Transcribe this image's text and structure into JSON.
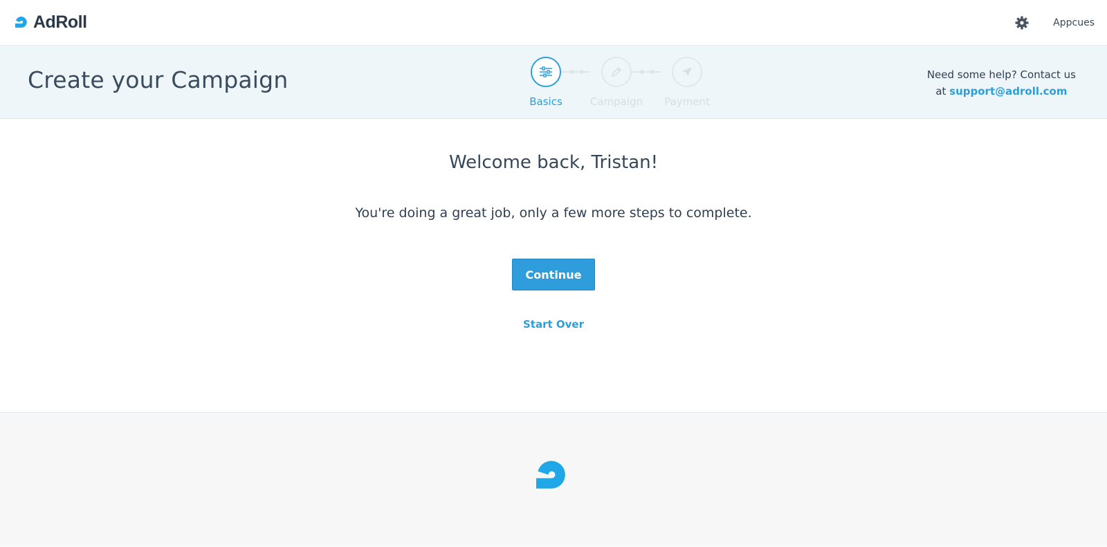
{
  "brand": {
    "name": "AdRoll",
    "accent_color": "#2c9fd9",
    "logo_color": "#1fa7e8"
  },
  "topbar": {
    "settings_icon": "gear-icon",
    "account_name": "Appcues"
  },
  "header": {
    "title": "Create your Campaign",
    "steps": [
      {
        "label": "Basics",
        "icon": "sliders-icon",
        "state": "active"
      },
      {
        "label": "Campaign",
        "icon": "pencil-icon",
        "state": "inactive"
      },
      {
        "label": "Payment",
        "icon": "rocket-icon",
        "state": "inactive"
      }
    ],
    "help": {
      "line1": "Need some help? Contact us",
      "prefix": "at",
      "email": "support@adroll.com"
    }
  },
  "main": {
    "welcome": "Welcome back, Tristan!",
    "subtitle": "You're doing a great job, only a few more steps to complete.",
    "continue_label": "Continue",
    "start_over_label": "Start Over"
  }
}
